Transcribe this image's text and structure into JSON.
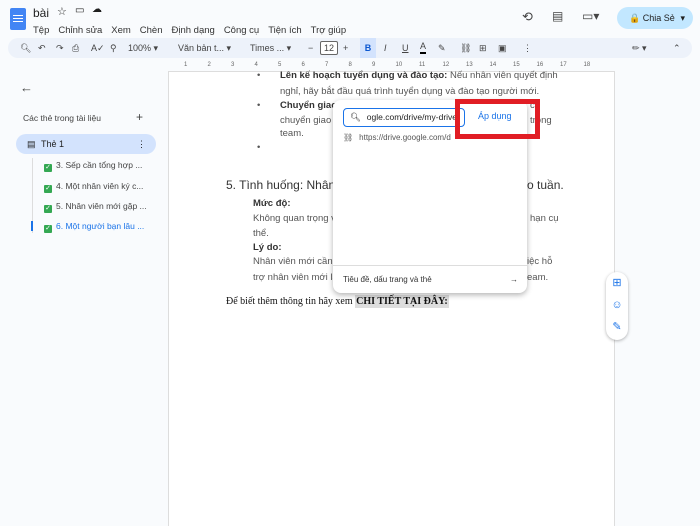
{
  "header": {
    "title": "bài",
    "menu": [
      "Tệp",
      "Chỉnh sửa",
      "Xem",
      "Chèn",
      "Định dạng",
      "Công cụ",
      "Tiện ích",
      "Trợ giúp"
    ],
    "share_label": "Chia Sẻ"
  },
  "toolbar": {
    "zoom": "100%",
    "style": "Văn bản t...",
    "font": "Times ...",
    "font_size": "12"
  },
  "ruler": [
    "1",
    "2",
    "3",
    "4",
    "5",
    "6",
    "7",
    "8",
    "9",
    "10",
    "11",
    "12",
    "13",
    "14",
    "15",
    "16",
    "17",
    "18"
  ],
  "sidebar": {
    "heading": "Các thẻ trong tài liệu",
    "tab": "Thẻ 1",
    "items": [
      "3. Sếp cần tổng hợp ...",
      "4. Một nhân viên ký c...",
      "5. Nhân viên mới gặp ...",
      "6. Một người bạn lâu ..."
    ]
  },
  "doc": {
    "b1_bold": "Lên kế hoạch tuyển dụng và đào tạo:",
    "b1_text": " Nếu nhân viên quyết định",
    "b1_line2": "nghỉ, hãy bắt đầu quá trình tuyển dụng và đào tạo người mới.",
    "b2_bold": "Chuyển giao",
    "b2_tail": "c",
    "b2_line2": "chuyển giao c",
    "b2_line2_tail": "trong",
    "b2_line3": "team.",
    "heading": "5. Tình huống: Nhân viê",
    "heading_tail": "o tuần.",
    "level_label": "Mức độ:",
    "level_text": "Không quan trọng v",
    "level_tail": "hạn cụ",
    "level_line2": "thể.",
    "reason_label": "Lý do:",
    "reason_text": "Nhân viên mới cần t",
    "reason_tail": "iệc hỗ",
    "reason_line2": "trợ nhân viên mới là",
    "reason_line2_tail": "eam.",
    "footer_text": "Để biết thêm thông tin hãy xem ",
    "footer_bold": "CHI TIẾT TẠI ĐÂY:"
  },
  "link_popup": {
    "input_value": "ogle.com/drive/my-drive",
    "apply_label": "Áp dụng",
    "suggestion": "https://drive.google.com/d",
    "bottom_label": "Tiêu đề, dấu trang và thẻ"
  },
  "colors": {
    "accent": "#1a73e8",
    "highlight": "#e11d24",
    "share_bg": "#c2e7ff"
  }
}
